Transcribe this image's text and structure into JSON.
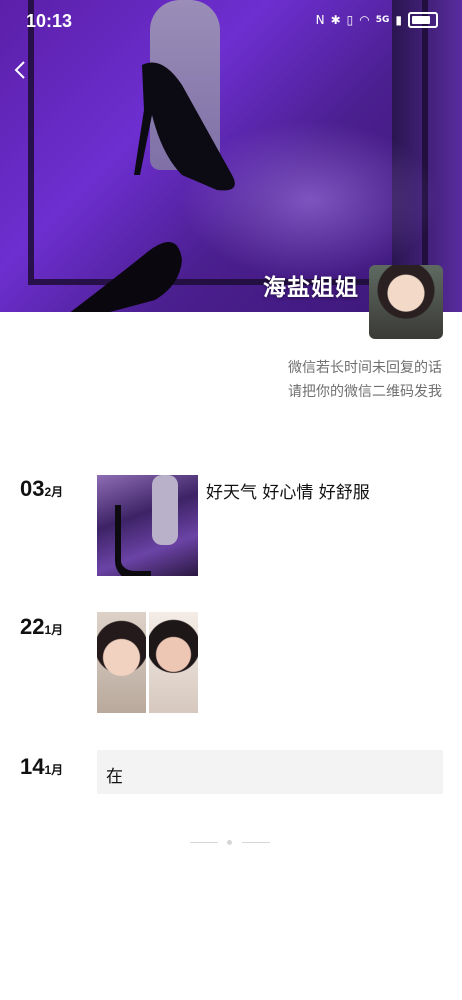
{
  "status_bar": {
    "time": "10:13",
    "network": "5G"
  },
  "profile": {
    "nickname": "海盐姐姐",
    "signature_line1": "微信若长时间未回复的话",
    "signature_line2": "请把你的微信二维码发我"
  },
  "posts": [
    {
      "day": "03",
      "month": "2月",
      "text": "好天气 好心情 好舒服",
      "images": 1
    },
    {
      "day": "22",
      "month": "1月",
      "text": "",
      "images": 2
    },
    {
      "day": "14",
      "month": "1月",
      "text": "在",
      "images": 0
    }
  ],
  "icons": [
    "back-chevron-icon",
    "nfc-icon",
    "bluetooth-icon",
    "vibrate-icon",
    "wifi-icon",
    "signal-icon",
    "battery-icon"
  ]
}
